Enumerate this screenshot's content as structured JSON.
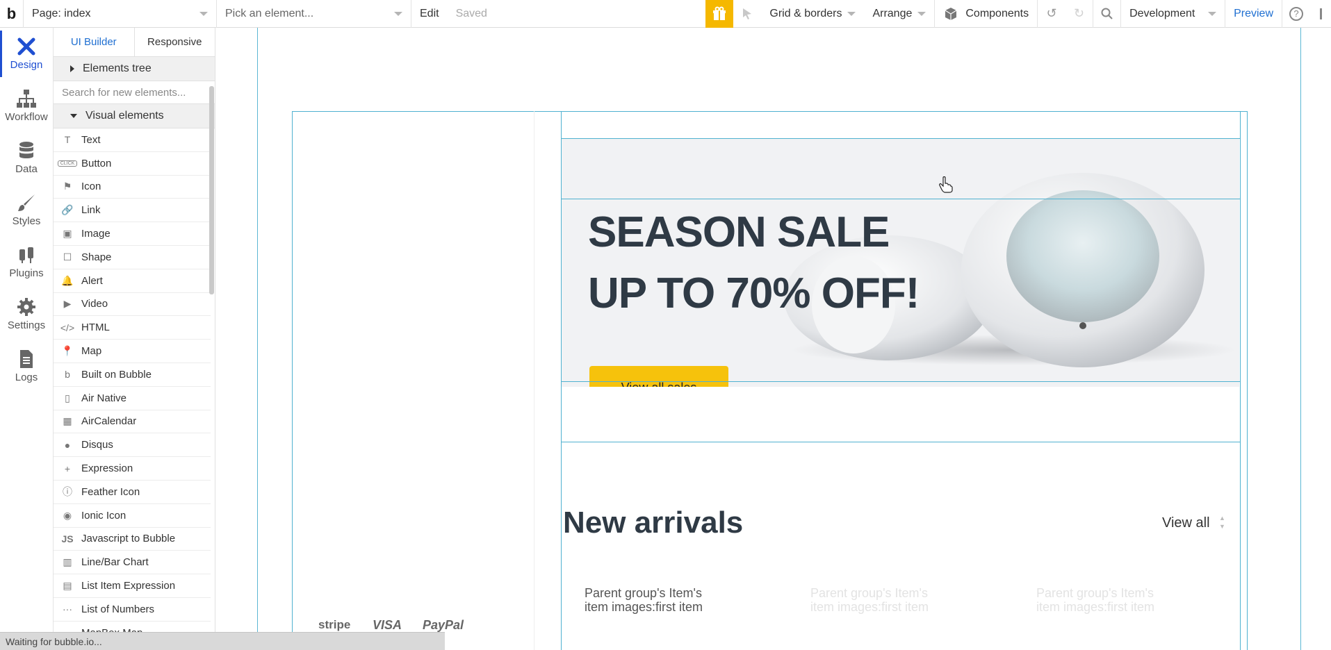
{
  "topbar": {
    "logo": "b",
    "page_selector": "Page: index",
    "element_picker": "Pick an element...",
    "edit": "Edit",
    "saved": "Saved",
    "grid_borders": "Grid & borders",
    "arrange": "Arrange",
    "components": "Components",
    "environment": "Development",
    "preview": "Preview",
    "help": "?"
  },
  "nav": [
    {
      "label": "Design",
      "icon": "design-icon"
    },
    {
      "label": "Workflow",
      "icon": "workflow-icon"
    },
    {
      "label": "Data",
      "icon": "database-icon"
    },
    {
      "label": "Styles",
      "icon": "brush-icon"
    },
    {
      "label": "Plugins",
      "icon": "plug-icon"
    },
    {
      "label": "Settings",
      "icon": "gear-icon"
    },
    {
      "label": "Logs",
      "icon": "document-icon"
    }
  ],
  "panel": {
    "tabs": [
      "UI Builder",
      "Responsive"
    ],
    "elements_tree": "Elements tree",
    "search_placeholder": "Search for new elements...",
    "visual_elements": "Visual elements",
    "items": [
      {
        "label": "Text",
        "icon": "T"
      },
      {
        "label": "Button",
        "icon": "CLICK"
      },
      {
        "label": "Icon",
        "icon": "⚑"
      },
      {
        "label": "Link",
        "icon": "🔗"
      },
      {
        "label": "Image",
        "icon": "▣"
      },
      {
        "label": "Shape",
        "icon": "☐"
      },
      {
        "label": "Alert",
        "icon": "🔔"
      },
      {
        "label": "Video",
        "icon": "▶"
      },
      {
        "label": "HTML",
        "icon": "</>"
      },
      {
        "label": "Map",
        "icon": "📍"
      },
      {
        "label": "Built on Bubble",
        "icon": "b"
      },
      {
        "label": "Air Native",
        "icon": "▯"
      },
      {
        "label": "AirCalendar",
        "icon": "▦"
      },
      {
        "label": "Disqus",
        "icon": "●"
      },
      {
        "label": "Expression",
        "icon": "+"
      },
      {
        "label": "Feather Icon",
        "icon": "ⓘ"
      },
      {
        "label": "Ionic Icon",
        "icon": "◉"
      },
      {
        "label": "Javascript to Bubble",
        "icon": "JS"
      },
      {
        "label": "Line/Bar Chart",
        "icon": "▥"
      },
      {
        "label": "List Item Expression",
        "icon": "▤"
      },
      {
        "label": "List of Numbers",
        "icon": "···"
      },
      {
        "label": "MapBox Map",
        "icon": "▬"
      }
    ]
  },
  "canvas": {
    "hero_line1": "SEASON SALE",
    "hero_line2": "UP TO 70% OFF!",
    "hero_button": "View all sales",
    "section_title": "New arrivals",
    "view_all": "View all",
    "item_text_1": "Parent group's Item's",
    "item_text_2": "item  images:first item",
    "item_faded_1a": "Parent group's Item's",
    "item_faded_1b": "item images:first item",
    "item_faded_2a": "Parent group's Item's",
    "item_faded_2b": "item images:first item",
    "payments": [
      "stripe",
      "VISA",
      "PayPal"
    ]
  },
  "status": "Waiting for bubble.io..."
}
